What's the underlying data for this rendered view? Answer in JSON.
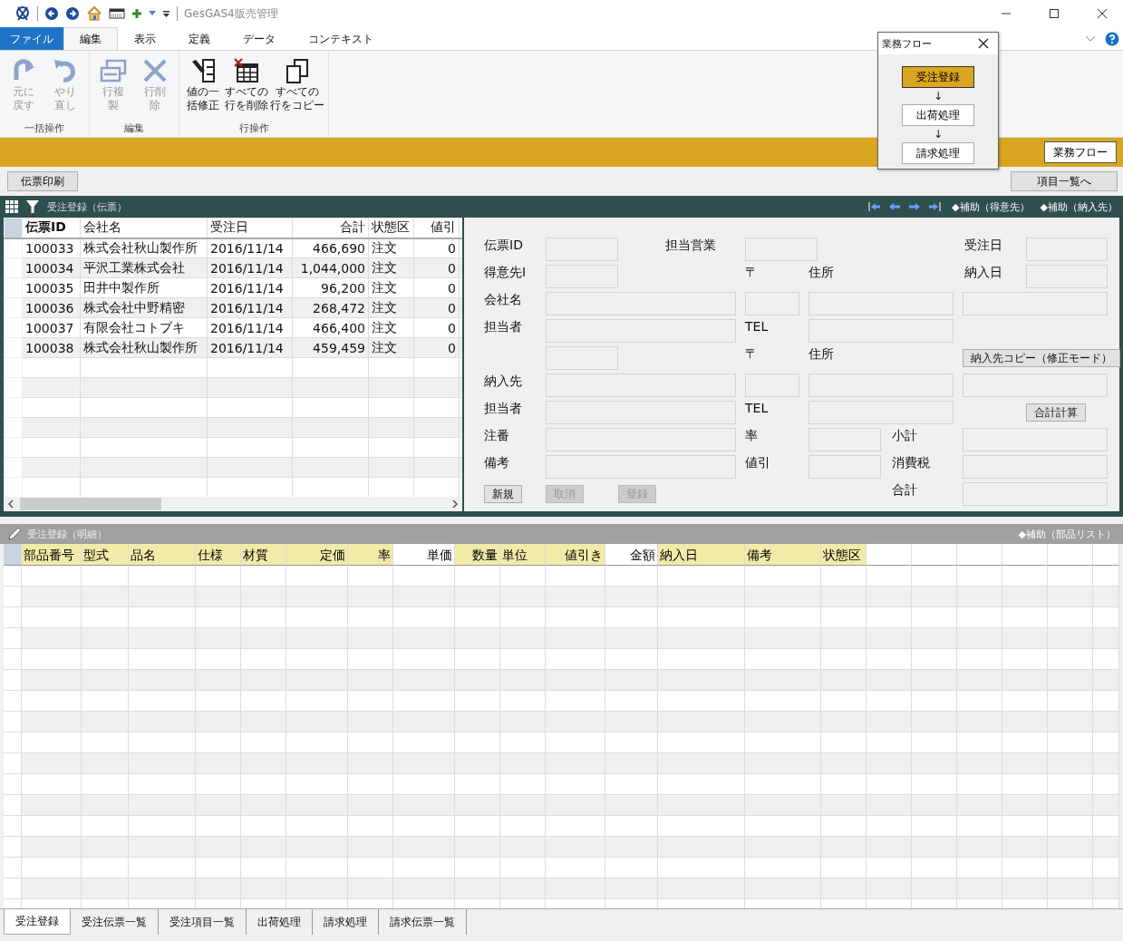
{
  "title_bar": {
    "app_title": "GesGAS4販売管理"
  },
  "ribbon": {
    "tabs": [
      {
        "label": "ファイル",
        "kind": "file",
        "selected": false
      },
      {
        "label": "編集",
        "kind": "tab",
        "selected": true
      },
      {
        "label": "表示",
        "kind": "tab",
        "selected": false
      },
      {
        "label": "定義",
        "kind": "tab",
        "selected": false
      },
      {
        "label": "データ",
        "kind": "tab",
        "selected": false
      },
      {
        "label": "コンテキスト",
        "kind": "tab",
        "selected": false
      }
    ],
    "groups": [
      {
        "label": "一括操作",
        "buttons": [
          {
            "lines": [
              "元に",
              "戻す"
            ],
            "kind": "redo",
            "disabled": true
          },
          {
            "lines": [
              "やり",
              "直し"
            ],
            "kind": "undo",
            "disabled": true
          }
        ]
      },
      {
        "label": "編集",
        "buttons": [
          {
            "lines": [
              "行複",
              "製"
            ],
            "kind": "duplicate",
            "disabled": true
          },
          {
            "lines": [
              "行削",
              "除"
            ],
            "kind": "delete",
            "disabled": true
          }
        ]
      },
      {
        "label": "行操作",
        "buttons": [
          {
            "lines": [
              "値の一",
              "括修正"
            ],
            "kind": "edit",
            "disabled": false
          },
          {
            "lines": [
              "すべての",
              "行を削除"
            ],
            "kind": "clear",
            "disabled": false
          },
          {
            "lines": [
              "すべての",
              "行をコピー"
            ],
            "kind": "copy",
            "disabled": false
          }
        ]
      }
    ]
  },
  "action_bar": {
    "flow_button": "業務フロー"
  },
  "toolbar": {
    "print_button": "伝票印刷",
    "list_button": "項目一覧へ"
  },
  "slip_panel": {
    "title": "受注登録（伝票）",
    "links": [
      "◆補助（得意先）",
      "◆補助（納入先）"
    ]
  },
  "slip_grid": {
    "columns": [
      "伝票ID",
      "会社名",
      "受注日",
      "合計",
      "状態区",
      "値引"
    ],
    "rows": [
      [
        "100033",
        "株式会社秋山製作所",
        "2016/11/14",
        "466,690",
        "注文",
        "0"
      ],
      [
        "100034",
        "平沢工業株式会社",
        "2016/11/14",
        "1,044,000",
        "注文",
        "0"
      ],
      [
        "100035",
        "田井中製作所",
        "2016/11/14",
        "96,200",
        "注文",
        "0"
      ],
      [
        "100036",
        "株式会社中野精密",
        "2016/11/14",
        "268,472",
        "注文",
        "0"
      ],
      [
        "100037",
        "有限会社コトブキ",
        "2016/11/14",
        "466,400",
        "注文",
        "0"
      ],
      [
        "100038",
        "株式会社秋山製作所",
        "2016/11/14",
        "459,459",
        "注文",
        "0"
      ]
    ]
  },
  "form": {
    "rows": [
      [
        {
          "kind": "label",
          "text": "伝票ID"
        },
        {
          "kind": "field"
        },
        {
          "kind": "label",
          "text": "担当営業"
        },
        {
          "kind": "field"
        },
        {
          "kind": "label",
          "text": "受注日"
        },
        {
          "kind": "field"
        }
      ],
      [
        {
          "kind": "label",
          "text": "得意先I"
        },
        {
          "kind": "field"
        },
        {
          "kind": "label",
          "text": "〒"
        },
        {
          "kind": "label",
          "text": "住所"
        },
        {
          "kind": "label",
          "text": "納入日"
        },
        {
          "kind": "field"
        }
      ],
      [
        {
          "kind": "label",
          "text": "会社名"
        },
        {
          "kind": "field"
        },
        {
          "kind": "field"
        },
        {
          "kind": "field"
        },
        {
          "kind": "field"
        }
      ],
      [
        {
          "kind": "label",
          "text": "担当者"
        },
        {
          "kind": "field"
        },
        {
          "kind": "label",
          "text": "TEL"
        },
        {
          "kind": "field"
        }
      ],
      [
        {
          "kind": "empty"
        },
        {
          "kind": "field"
        },
        {
          "kind": "label",
          "text": "〒"
        },
        {
          "kind": "label",
          "text": "住所"
        },
        {
          "kind": "button",
          "text": "納入先コピー（修正モード）",
          "disabled": false
        }
      ],
      [
        {
          "kind": "label",
          "text": "納入先"
        },
        {
          "kind": "field"
        },
        {
          "kind": "field"
        },
        {
          "kind": "field"
        },
        {
          "kind": "field"
        }
      ],
      [
        {
          "kind": "label",
          "text": "担当者"
        },
        {
          "kind": "field"
        },
        {
          "kind": "label",
          "text": "TEL"
        },
        {
          "kind": "field"
        },
        {
          "kind": "button",
          "text": "合計計算",
          "disabled": false
        }
      ],
      [
        {
          "kind": "label",
          "text": "注番"
        },
        {
          "kind": "field"
        },
        {
          "kind": "label",
          "text": "率"
        },
        {
          "kind": "field"
        },
        {
          "kind": "label",
          "text": "小計"
        },
        {
          "kind": "field"
        }
      ],
      [
        {
          "kind": "label",
          "text": "備考"
        },
        {
          "kind": "field"
        },
        {
          "kind": "label",
          "text": "値引"
        },
        {
          "kind": "field"
        },
        {
          "kind": "label",
          "text": "消費税"
        },
        {
          "kind": "field"
        }
      ],
      [
        {
          "kind": "button",
          "text": "新規",
          "disabled": false
        },
        {
          "kind": "button",
          "text": "取消",
          "disabled": true
        },
        {
          "kind": "button",
          "text": "登録",
          "disabled": true
        },
        {
          "kind": "label",
          "text": "合計"
        },
        {
          "kind": "field"
        }
      ]
    ]
  },
  "detail_panel": {
    "title": "受注登録（明細）",
    "link": "◆補助（部品リスト）"
  },
  "detail_grid": {
    "columns": [
      {
        "label": "部品番号",
        "highlighted": true
      },
      {
        "label": "型式",
        "highlighted": true
      },
      {
        "label": "品名",
        "highlighted": true
      },
      {
        "label": "仕様",
        "highlighted": true
      },
      {
        "label": "材質",
        "highlighted": true
      },
      {
        "label": "定価",
        "highlighted": true
      },
      {
        "label": "率",
        "highlighted": true
      },
      {
        "label": "単価",
        "highlighted": false
      },
      {
        "label": "数量",
        "highlighted": true
      },
      {
        "label": "単位",
        "highlighted": true
      },
      {
        "label": "値引き",
        "highlighted": true
      },
      {
        "label": "金額",
        "highlighted": false
      },
      {
        "label": "納入日",
        "highlighted": true
      },
      {
        "label": "備考",
        "highlighted": true
      },
      {
        "label": "状態区",
        "highlighted": true
      }
    ]
  },
  "bottom_tabs": [
    {
      "label": "受注登録",
      "selected": true
    },
    {
      "label": "受注伝票一覧",
      "selected": false
    },
    {
      "label": "受注項目一覧",
      "selected": false
    },
    {
      "label": "出荷処理",
      "selected": false
    },
    {
      "label": "請求処理",
      "selected": false
    },
    {
      "label": "請求伝票一覧",
      "selected": false
    }
  ],
  "flow_popup": {
    "title": "業務フロー",
    "items": [
      {
        "kind": "step",
        "label": "受注登録",
        "selected": true
      },
      {
        "kind": "arrow",
        "label": "↓"
      },
      {
        "kind": "step",
        "label": "出荷処理",
        "selected": false
      },
      {
        "kind": "arrow",
        "label": "↓"
      },
      {
        "kind": "step",
        "label": "請求処理",
        "selected": false
      }
    ]
  }
}
